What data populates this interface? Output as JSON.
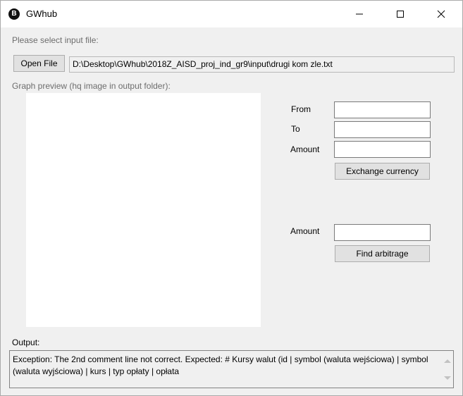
{
  "window": {
    "title": "GWhub",
    "app_icon_glyph": "B",
    "app_icon_name": "bitcoin-icon"
  },
  "input_section": {
    "prompt": "Please select input file:",
    "open_file_label": "Open File",
    "file_path": "D:\\Desktop\\GWhub\\2018Z_AISD_proj_ind_gr9\\input\\drugi kom zle.txt"
  },
  "preview": {
    "label": "Graph preview (hq image in output folder):"
  },
  "exchange": {
    "from_label": "From",
    "from_value": "",
    "to_label": "To",
    "to_value": "",
    "amount_label": "Amount",
    "amount_value": "",
    "button_label": "Exchange currency"
  },
  "arbitrage": {
    "amount_label": "Amount",
    "amount_value": "",
    "button_label": "Find arbitrage"
  },
  "output": {
    "label": "Output:",
    "text": "Exception: The 2nd comment line not correct. Expected: # Kursy walut (id | symbol (waluta wejściowa) | symbol (waluta wyjściowa) | kurs | typ opłaty | opłata"
  }
}
